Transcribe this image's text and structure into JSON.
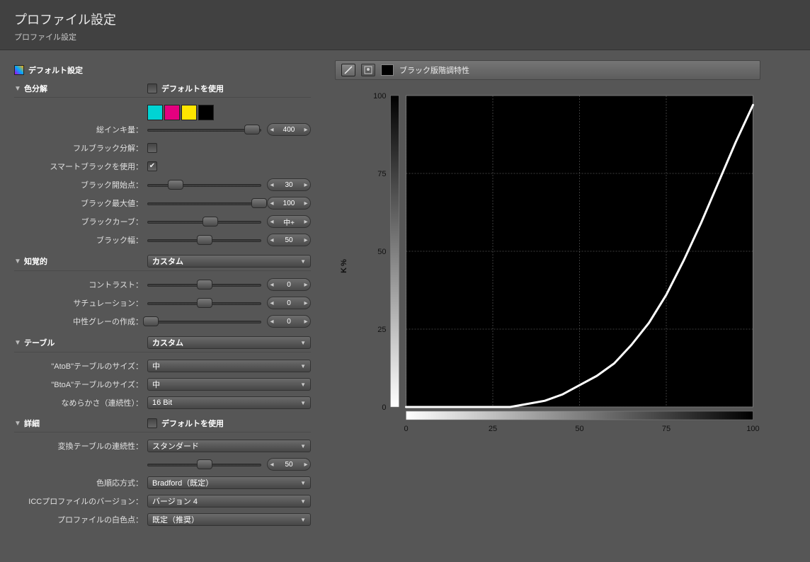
{
  "header": {
    "title": "プロファイル設定",
    "subtitle": "プロファイル設定"
  },
  "defaults_section": "デフォルト設定",
  "sep": {
    "title": "色分解",
    "use_default": "デフォルトを使用",
    "swatches": [
      "#00d4d4",
      "#e4007f",
      "#ffe600",
      "#000000"
    ],
    "total_ink": {
      "label": "総インキ量：",
      "value": "400"
    },
    "full_black": {
      "label": "フルブラック分解："
    },
    "smart_black": {
      "label": "スマートブラックを使用："
    },
    "black_start": {
      "label": "ブラック開始点：",
      "value": "30"
    },
    "black_max": {
      "label": "ブラック最大値：",
      "value": "100"
    },
    "black_curve": {
      "label": "ブラックカーブ：",
      "value": "中+"
    },
    "black_width": {
      "label": "ブラック幅：",
      "value": "50"
    }
  },
  "perc": {
    "title": "知覚的",
    "head_select": "カスタム",
    "contrast": {
      "label": "コントラスト：",
      "value": "0"
    },
    "saturation": {
      "label": "サチュレーション：",
      "value": "0"
    },
    "gray_gen": {
      "label": "中性グレーの作成：",
      "value": "0"
    }
  },
  "table": {
    "title": "テーブル",
    "head_select": "カスタム",
    "atob": {
      "label": "\"AtoB\"テーブルのサイズ：",
      "value": "中"
    },
    "btoa": {
      "label": "\"BtoA\"テーブルのサイズ：",
      "value": "中"
    },
    "smooth": {
      "label": "なめらかさ（連続性）：",
      "value": "16 Bit"
    }
  },
  "adv": {
    "title": "詳細",
    "use_default": "デフォルトを使用",
    "cont": {
      "label": "変換テーブルの連続性：",
      "value": "スタンダード",
      "slider_value": "50"
    },
    "adapt": {
      "label": "色順応方式：",
      "value": "Bradford（既定）"
    },
    "ver": {
      "label": "ICCプロファイルのバージョン：",
      "value": "バージョン 4"
    },
    "wp": {
      "label": "プロファイルの白色点：",
      "value": "既定（推奨）"
    }
  },
  "graph": {
    "title": "ブラック版階調特性",
    "ylabel": "K%"
  },
  "chart_data": {
    "type": "line",
    "title": "ブラック版階調特性",
    "xlabel": "",
    "ylabel": "K%",
    "xlim": [
      0,
      100
    ],
    "ylim": [
      0,
      100
    ],
    "xticks": [
      0,
      25,
      50,
      75,
      100
    ],
    "yticks": [
      0,
      25,
      50,
      75,
      100
    ],
    "series": [
      {
        "name": "K",
        "x": [
          0,
          10,
          20,
          30,
          35,
          40,
          45,
          50,
          55,
          60,
          65,
          70,
          75,
          80,
          85,
          90,
          95,
          100
        ],
        "y": [
          0,
          0,
          0,
          0,
          1,
          2,
          4,
          7,
          10,
          14,
          20,
          27,
          36,
          47,
          59,
          72,
          85,
          97
        ]
      }
    ]
  }
}
